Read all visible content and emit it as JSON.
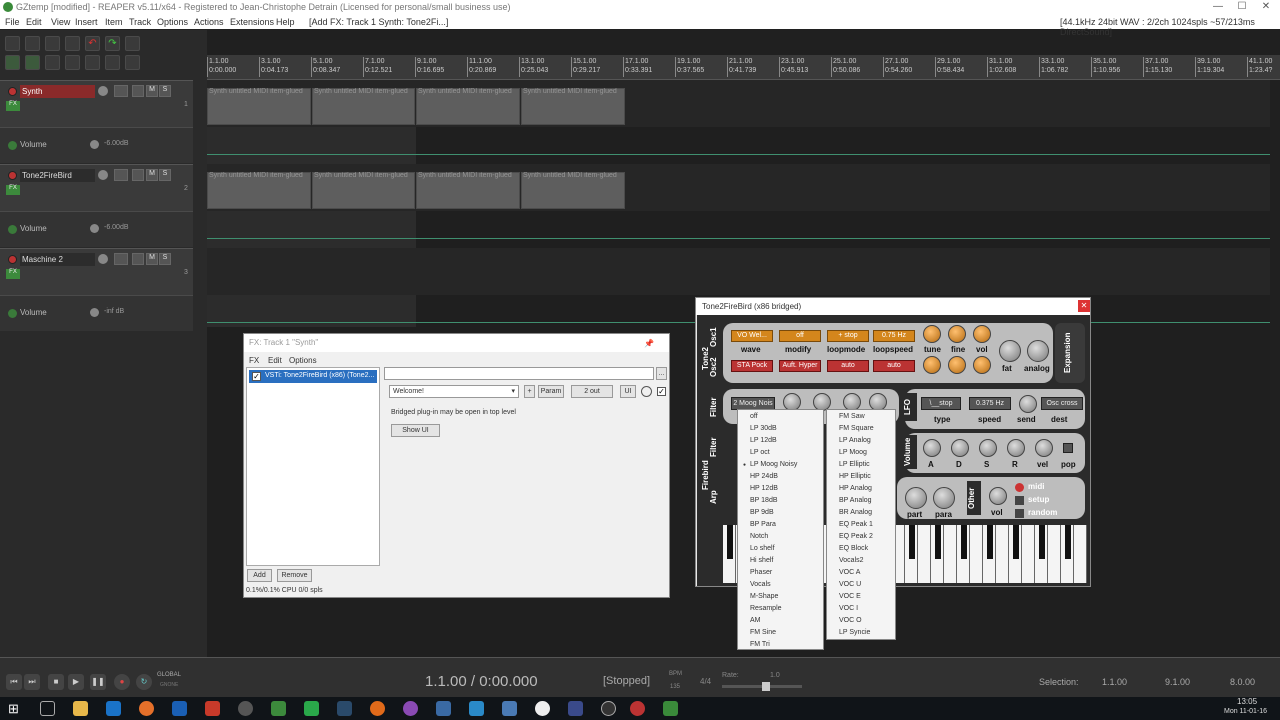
{
  "window": {
    "title": "GZtemp [modified] - REAPER v5.11/x64 - Registered to Jean-Christophe Detrain (Licensed for personal/small business use)",
    "min": "—",
    "max": "☐",
    "close": "✕"
  },
  "menu": {
    "items": [
      "File",
      "Edit",
      "View",
      "Insert",
      "Item",
      "Track",
      "Options",
      "Actions",
      "Extensions",
      "Help"
    ],
    "hint": "[Add FX: Track 1 Synth: Tone2Fi...]",
    "status": "[44.1kHz 24bit WAV : 2/2ch 1024spls ~57/213ms DirectSound]"
  },
  "ruler": {
    "marks": [
      {
        "bar": "1.1.00",
        "time": "0:00.000"
      },
      {
        "bar": "3.1.00",
        "time": "0:04.173"
      },
      {
        "bar": "5.1.00",
        "time": "0:08.347"
      },
      {
        "bar": "7.1.00",
        "time": "0:12.521"
      },
      {
        "bar": "9.1.00",
        "time": "0:16.695"
      },
      {
        "bar": "11.1.00",
        "time": "0:20.869"
      },
      {
        "bar": "13.1.00",
        "time": "0:25.043"
      },
      {
        "bar": "15.1.00",
        "time": "0:29.217"
      },
      {
        "bar": "17.1.00",
        "time": "0:33.391"
      },
      {
        "bar": "19.1.00",
        "time": "0:37.565"
      },
      {
        "bar": "21.1.00",
        "time": "0:41.739"
      },
      {
        "bar": "23.1.00",
        "time": "0:45.913"
      },
      {
        "bar": "25.1.00",
        "time": "0:50.086"
      },
      {
        "bar": "27.1.00",
        "time": "0:54.260"
      },
      {
        "bar": "29.1.00",
        "time": "0:58.434"
      },
      {
        "bar": "31.1.00",
        "time": "1:02.608"
      },
      {
        "bar": "33.1.00",
        "time": "1:06.782"
      },
      {
        "bar": "35.1.00",
        "time": "1:10.956"
      },
      {
        "bar": "37.1.00",
        "time": "1:15.130"
      },
      {
        "bar": "39.1.00",
        "time": "1:19.304"
      },
      {
        "bar": "41.1.00",
        "time": "1:23.4?"
      }
    ]
  },
  "tracks": [
    {
      "name": "Synth",
      "num": "1",
      "m": "M",
      "s": "S",
      "fx": "FX",
      "env": "Volume",
      "env_val": "-6.00dB",
      "item": "Synth untitled MIDI item-glued"
    },
    {
      "name": "Tone2FireBird",
      "num": "2",
      "m": "M",
      "s": "S",
      "fx": "FX",
      "env": "Volume",
      "env_val": "-6.00dB",
      "item": "Synth untitled MIDI item-glued"
    },
    {
      "name": "Maschine 2",
      "num": "3",
      "m": "M",
      "s": "S",
      "fx": "FX",
      "env": "Volume",
      "env_val": "-inf dB",
      "item": ""
    }
  ],
  "fx_window": {
    "title": "FX: Track 1 \"Synth\"",
    "menu": [
      "FX",
      "Edit",
      "Options"
    ],
    "plugin": "VSTi: Tone2FireBird (x86) (Tone2...",
    "preset": "Welcome!",
    "plus": "+",
    "param": "Param",
    "out": "2 out",
    "ui": "UI",
    "message": "Bridged plug-in may be open in top level",
    "show_ui": "Show UI",
    "add": "Add",
    "remove": "Remove",
    "cpu": "0.1%/0.1% CPU 0/0 spls",
    "more": "..."
  },
  "plugin_window": {
    "title": "Tone2FireBird (x86 bridged)",
    "osc1": {
      "wave": "VO Wel...",
      "modify": "off",
      "loopmode": "+ stop",
      "loopspeed": "0.75 Hz"
    },
    "osc2": {
      "wave": "STA Pock",
      "modify": "Auft. Hyper",
      "loopmode": "auto",
      "loopspeed": "auto"
    },
    "labels": {
      "wave": "wave",
      "modify": "modify",
      "loopmode": "loopmode",
      "loopspeed": "loopspeed",
      "tune": "tune",
      "fine": "fine",
      "vol": "vol",
      "fat": "fat",
      "analog": "analog",
      "expansion": "Expansion",
      "type": "type",
      "speed": "speed",
      "send": "send",
      "dest": "dest",
      "a": "A",
      "d": "D",
      "s": "S",
      "r": "R",
      "vel": "vel",
      "pop": "pop",
      "midi": "midi",
      "setup": "setup",
      "random": "random",
      "part": "part",
      "para": "para",
      "ovol": "vol",
      "osc1": "Osc1",
      "osc2": "Osc2",
      "filter": "Filter",
      "filter2": "Filter",
      "arp": "Arp",
      "lfo": "LFO",
      "volume": "Volume",
      "other": "Other",
      "brand": "Tone2",
      "brand2": "Firebird"
    },
    "filter_value": "2 Moog Nois",
    "lfo": {
      "type": "\\__stop",
      "speed": "0.375 Hz",
      "dest": "Osc cross"
    }
  },
  "filter_menu_1": [
    "off",
    "LP 30dB",
    "LP 12dB",
    "LP oct",
    "LP Moog Noisy",
    "HP 24dB",
    "HP 12dB",
    "BP 18dB",
    "BP 9dB",
    "BP Para",
    "Notch",
    "Lo shelf",
    "Hi shelf",
    "Phaser",
    "Vocals",
    "M-Shape",
    "Resample",
    "AM",
    "FM Sine",
    "FM Tri"
  ],
  "filter_menu_selected": "LP Moog Noisy",
  "filter_menu_2": [
    "FM Saw",
    "FM Square",
    "LP Analog",
    "LP Moog",
    "LP Elliptic",
    "HP Elliptic",
    "HP Analog",
    "BP Analog",
    "BR Analog",
    "EQ Peak 1",
    "EQ Peak 2",
    "EQ Block",
    "Vocals2",
    "VOC A",
    "VOC U",
    "VOC E",
    "VOC I",
    "VOC O",
    "LP Syncie"
  ],
  "transport": {
    "position": "1.1.00 / 0:00.000",
    "state": "[Stopped]",
    "bpm_label": "BPM",
    "bpm": "135",
    "sig": "4/4",
    "rate_label": "Rate:",
    "rate": "1.0",
    "sel_label": "Selection:",
    "sel_start": "1.1.00",
    "sel_end": "9.1.00",
    "sel_len": "8.0.00",
    "global": "GLOBAL",
    "gnone": "GNONE"
  },
  "clock": {
    "time": "13:05",
    "date": "Mon 11-01-16"
  }
}
